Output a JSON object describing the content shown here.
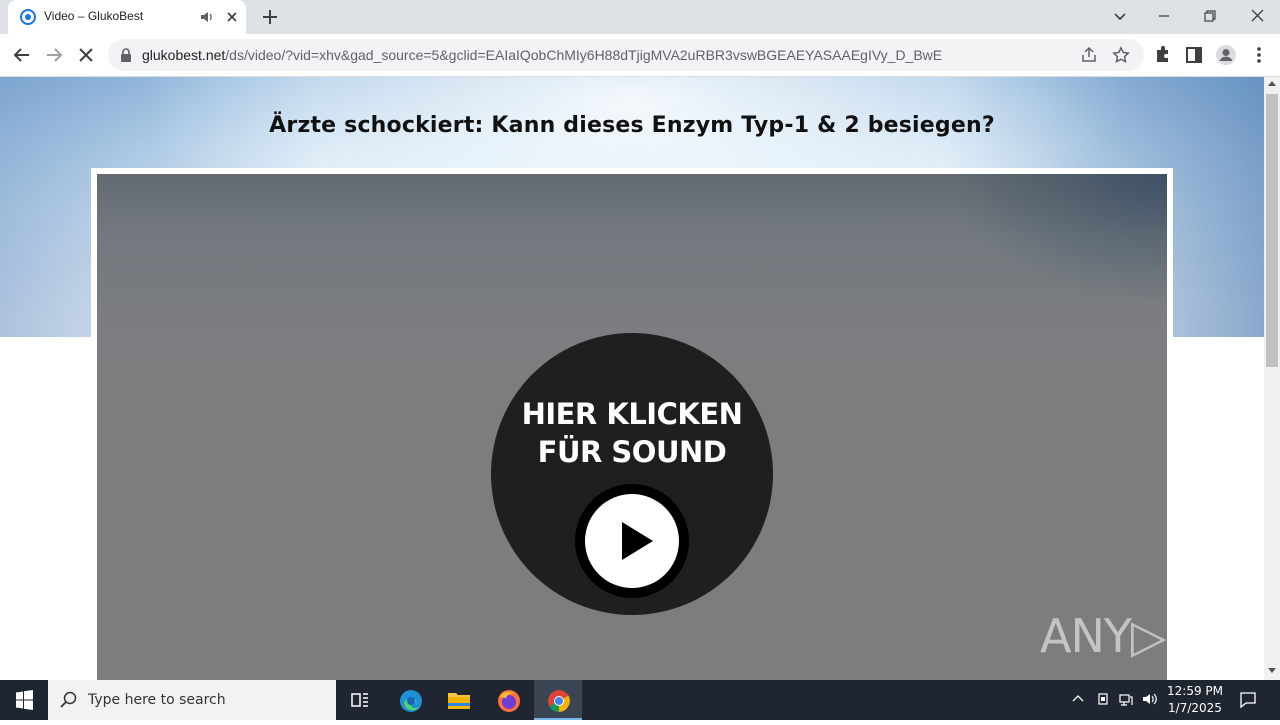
{
  "browser": {
    "tab_title": "Video – GlukoBest",
    "url_host": "glukobest.net",
    "url_rest": "/ds/video/?vid=xhv&gad_source=5&gclid=EAIaIQobChMIy6H88dTjigMVA2uRBR3vswBGEAEYASAAEgIVy_D_BwE"
  },
  "page": {
    "headline": "Ärzte schockiert: Kann dieses Enzym Typ-1 & 2 besiegen?",
    "sound_line1": "HIER KLICKEN",
    "sound_line2": "FÜR SOUND",
    "watermark": "ANY▷RUN"
  },
  "taskbar": {
    "search_placeholder": "Type here to search",
    "time": "12:59 PM",
    "date": "1/7/2025"
  },
  "icons": [
    "chrome-favicon-icon",
    "speaker-icon",
    "close-icon",
    "plus-icon",
    "back-icon",
    "forward-icon",
    "stop-icon",
    "lock-icon",
    "share-icon",
    "star-icon",
    "extensions-icon",
    "sidepanel-icon",
    "profile-icon",
    "menu-icon",
    "play-icon",
    "windows-icon",
    "search-icon",
    "taskview-icon",
    "edge-icon",
    "explorer-icon",
    "firefox-icon",
    "chrome-icon"
  ]
}
